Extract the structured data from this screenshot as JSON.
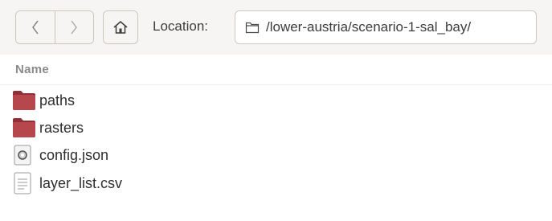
{
  "toolbar": {
    "back_icon": "chevron-left-icon",
    "forward_icon": "chevron-right-icon",
    "home_icon": "home-icon",
    "location_label": "Location:",
    "location_value": "/lower-austria/scenario-1-sal_bay/",
    "location_icon": "folder-outline-icon"
  },
  "list": {
    "header_name": "Name",
    "items": [
      {
        "name": "paths",
        "icon": "folder-icon"
      },
      {
        "name": "rasters",
        "icon": "folder-icon"
      },
      {
        "name": "config.json",
        "icon": "json-file-icon"
      },
      {
        "name": "layer_list.csv",
        "icon": "text-file-icon"
      }
    ]
  },
  "colors": {
    "folder": "#b5474d",
    "toolbar_bg": "#f6f5f4",
    "border": "#cdc7c2"
  }
}
